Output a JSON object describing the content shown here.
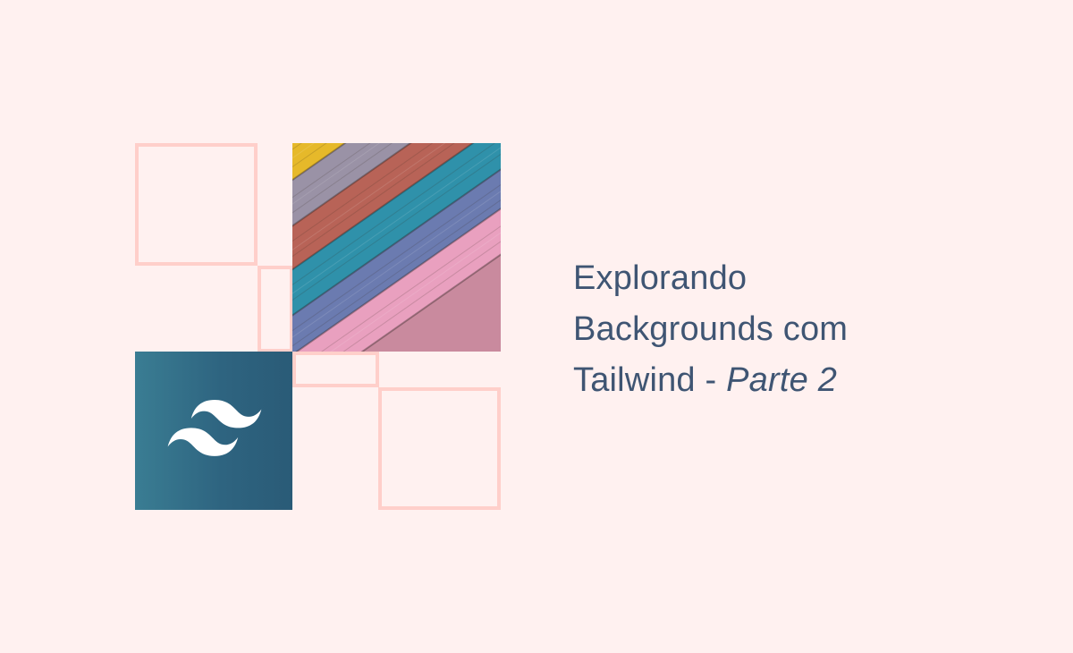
{
  "title": {
    "line1": "Explorando",
    "line2": "Backgrounds com",
    "line3_prefix": "Tailwind - ",
    "line3_italic": "Parte 2"
  },
  "colors": {
    "background": "#fff1f0",
    "outline": "#ffcfca",
    "text": "#3f5573",
    "logo_tile": "#2e6480",
    "logo_mark": "#ffffff"
  },
  "icons": {
    "logo": "tailwind-logo-icon",
    "texture": "striped-wood-texture"
  }
}
